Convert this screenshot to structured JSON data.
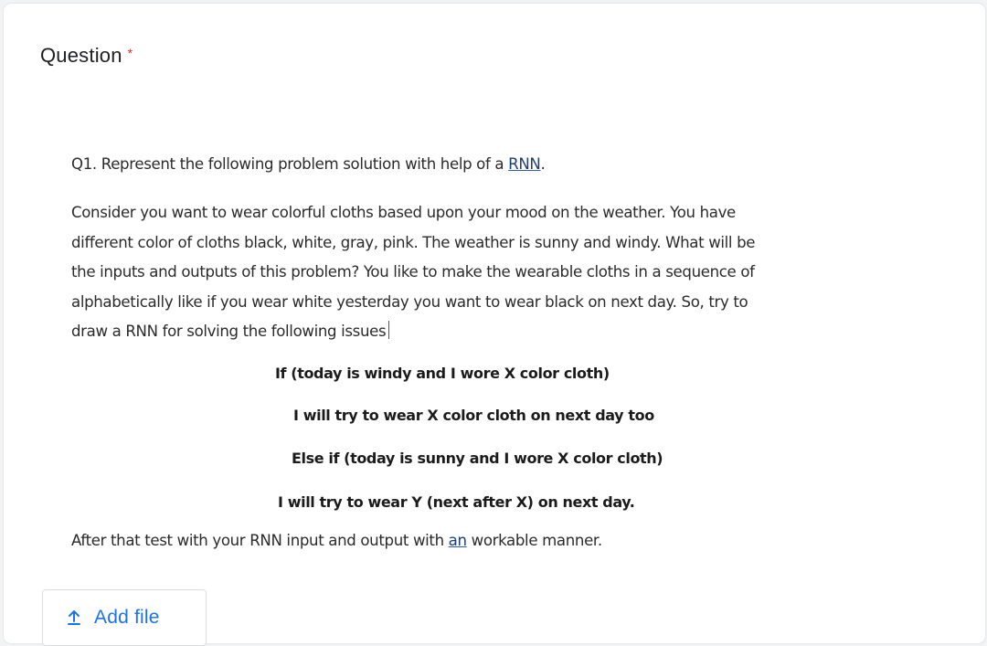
{
  "question": {
    "label": "Question",
    "required_mark": "*",
    "q1_prefix": "Q1. Represent the following problem solution with help of a ",
    "q1_link": "RNN",
    "q1_suffix": ".",
    "paragraph_lines": [
      "Consider you want to wear colorful cloths based upon your mood on the weather. You have",
      "different color of cloths black, white, gray, pink. The weather is sunny and windy.  What will be",
      "the inputs and outputs of this problem? You like to make the wearable cloths in a sequence of",
      "alphabetically like if you wear white yesterday you want to wear black on next day. So, try to",
      "draw a RNN for solving the following issues"
    ],
    "conditions": [
      "If (today is windy and I wore X color cloth)",
      "I will try to wear X color cloth on next day too",
      "Else if (today is sunny and I wore X color cloth)",
      "I will try to wear Y (next after X) on next day."
    ],
    "after_prefix": "After that test with your RNN input and output with ",
    "after_link": "an",
    "after_suffix": " workable manner."
  },
  "add_file": {
    "label": "Add file",
    "icon": "upload-icon"
  },
  "colors": {
    "accent": "#1a73e8",
    "required": "#d93025",
    "text": "#202124"
  }
}
